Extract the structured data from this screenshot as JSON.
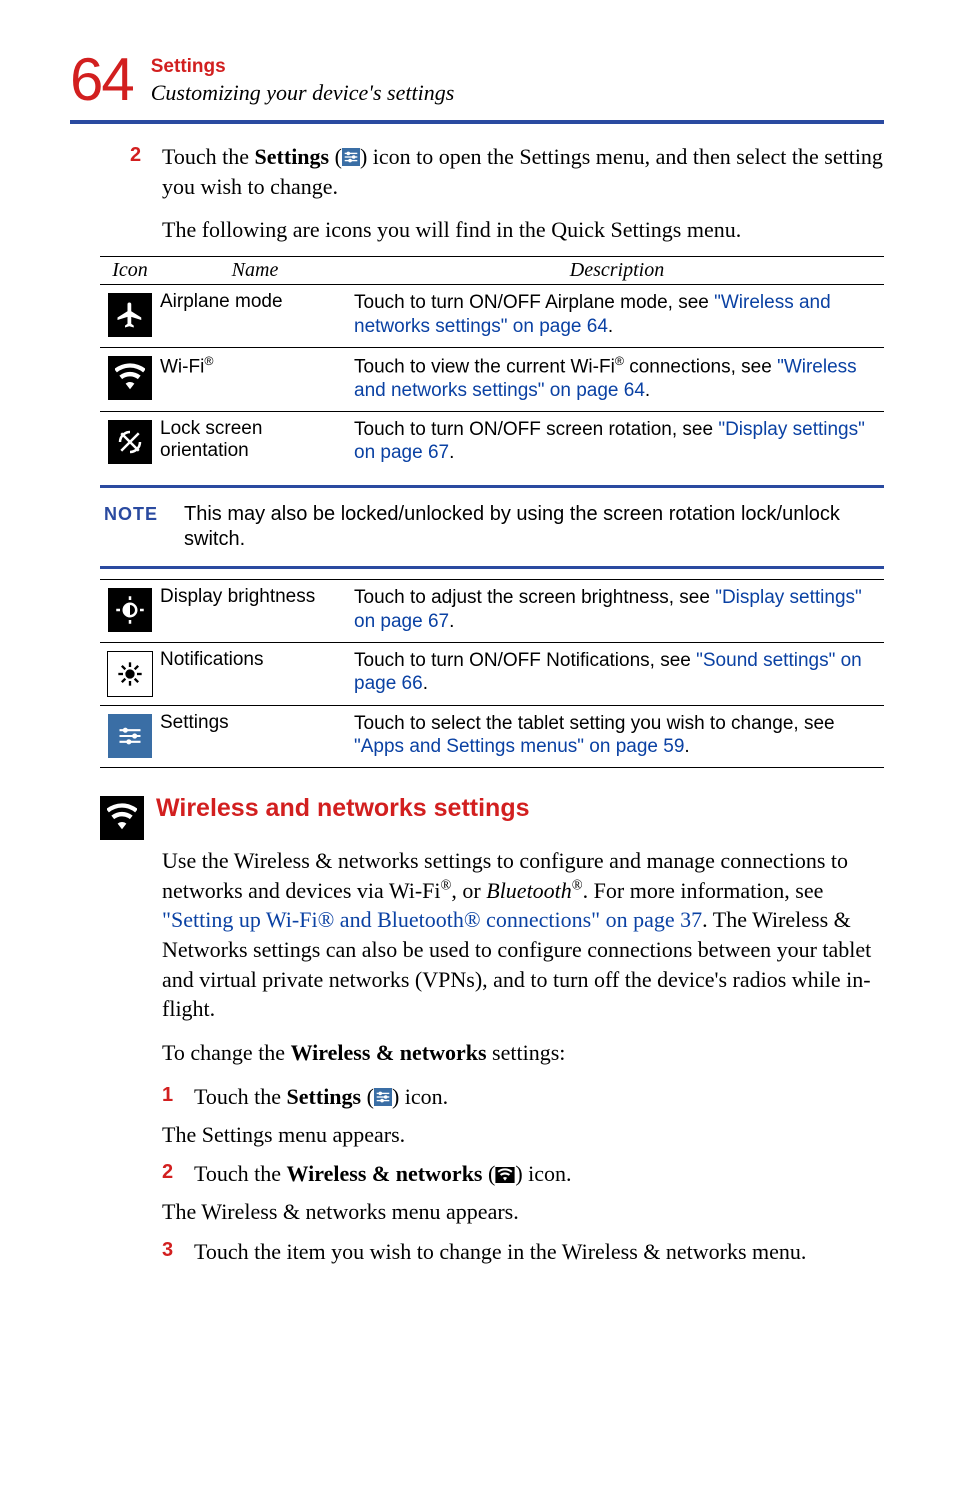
{
  "header": {
    "page_number": "64",
    "chapter": "Settings",
    "section": "Customizing your device's settings"
  },
  "intro_step": {
    "num": "2",
    "pre": "Touch the ",
    "b1": "Settings",
    "mid": " (",
    "post": ") icon to open the Settings menu, and then select the setting you wish to change."
  },
  "lead_para": "The following are icons you will find in the Quick Settings menu.",
  "table": {
    "h_icon": "Icon",
    "h_name": "Name",
    "h_desc": "Description",
    "rows": [
      {
        "name_html": "Airplane mode",
        "desc_pre": "Touch to turn ON/OFF Airplane mode, see ",
        "desc_link": "\"Wireless and networks settings\" on page 64",
        "desc_post": "."
      },
      {
        "name_html": "Wi-Fi",
        "name_sup": "®",
        "desc_pre": "Touch to view the current Wi-Fi",
        "desc_sup": "®",
        "desc_pre2": " connections, see ",
        "desc_link": "\"Wireless and networks settings\" on page 64",
        "desc_post": "."
      },
      {
        "name_html": "Lock screen orientation",
        "desc_pre": "Touch to turn ON/OFF screen rotation, see ",
        "desc_link": "\"Display settings\" on page 67",
        "desc_post": "."
      },
      {
        "name_html": "Display brightness",
        "desc_pre": "Touch to adjust the screen brightness, see ",
        "desc_link": "\"Display settings\" on page 67",
        "desc_post": "."
      },
      {
        "name_html": "Notifications",
        "desc_pre": "Touch to turn ON/OFF Notifications, see ",
        "desc_link": "\"Sound settings\" on page 66",
        "desc_post": "."
      },
      {
        "name_html": "Settings",
        "desc_pre": "Touch to select the tablet setting you wish to change, see ",
        "desc_link": "\"Apps and Settings menus\" on page 59",
        "desc_post": "."
      }
    ]
  },
  "note": {
    "label": "NOTE",
    "text": "This may also be locked/unlocked by using the screen rotation lock/unlock switch."
  },
  "section2": {
    "title": "Wireless and networks settings",
    "para_pre": "Use the Wireless & networks settings to configure and manage connections to networks and devices via Wi-Fi",
    "sup1": "®",
    "para_mid1": ", or ",
    "ital": "Bluetooth",
    "sup2": "®",
    "para_mid2": ". For more information, see ",
    "link": "\"Setting up Wi-Fi® and Bluetooth® connections\" on page 37",
    "para_post": ". The Wireless & Networks settings can also be used to configure connections between your tablet and virtual private networks (VPNs), and to turn off the device's radios while in-flight.",
    "change_lead_pre": "To change the ",
    "change_lead_b": "Wireless & networks",
    "change_lead_post": " settings:",
    "steps": [
      {
        "n": "1",
        "pre": "Touch the ",
        "b": "Settings",
        "mid": " (",
        "post": ") icon.",
        "after": "The Settings menu appears."
      },
      {
        "n": "2",
        "pre": "Touch the ",
        "b": "Wireless & networks",
        "mid": " (",
        "post": ") icon.",
        "after": "The Wireless & networks menu appears."
      },
      {
        "n": "3",
        "text": "Touch the item you wish to change in the Wireless & networks menu."
      }
    ]
  }
}
